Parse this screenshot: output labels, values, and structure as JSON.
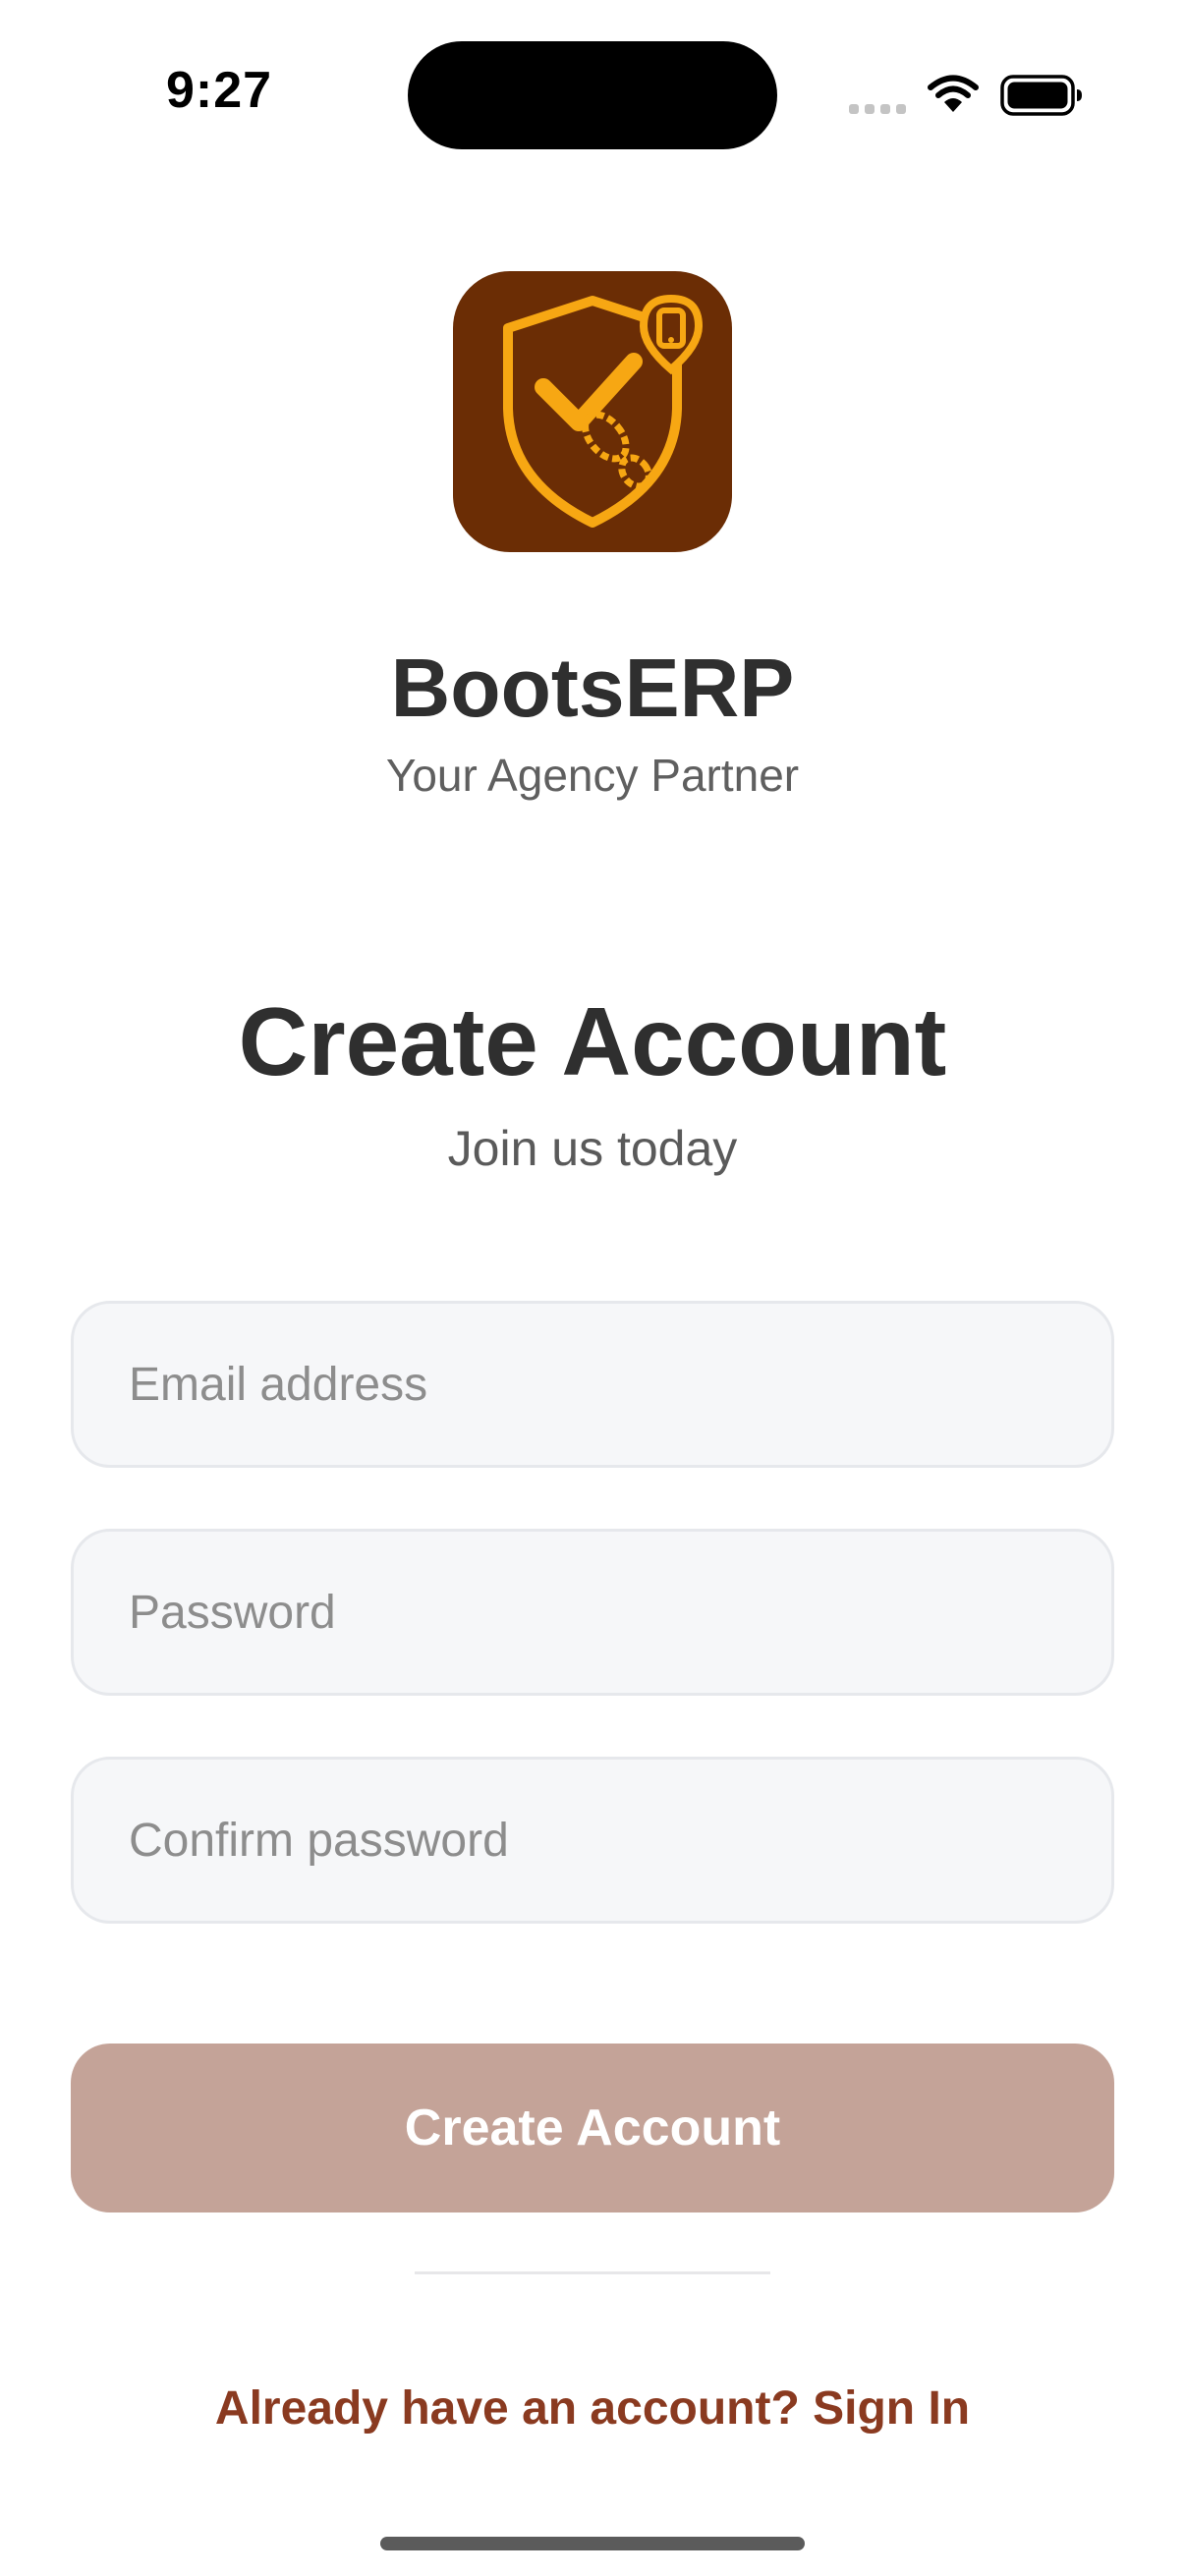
{
  "status_bar": {
    "time": "9:27"
  },
  "header": {
    "app_name": "BootsERP",
    "tagline": "Your Agency Partner",
    "logo_icon": "shield-check-footprint-phone-icon"
  },
  "form": {
    "title": "Create Account",
    "subtitle": "Join us today",
    "email_placeholder": "Email address",
    "password_placeholder": "Password",
    "confirm_placeholder": "Confirm password",
    "submit_label": "Create Account"
  },
  "footer": {
    "signin_text": "Already have an account? Sign In"
  },
  "colors": {
    "logo_background": "#6b2d05",
    "logo_accent": "#f7a713",
    "primary_button": "#c4a398",
    "link": "#8a3a20"
  }
}
